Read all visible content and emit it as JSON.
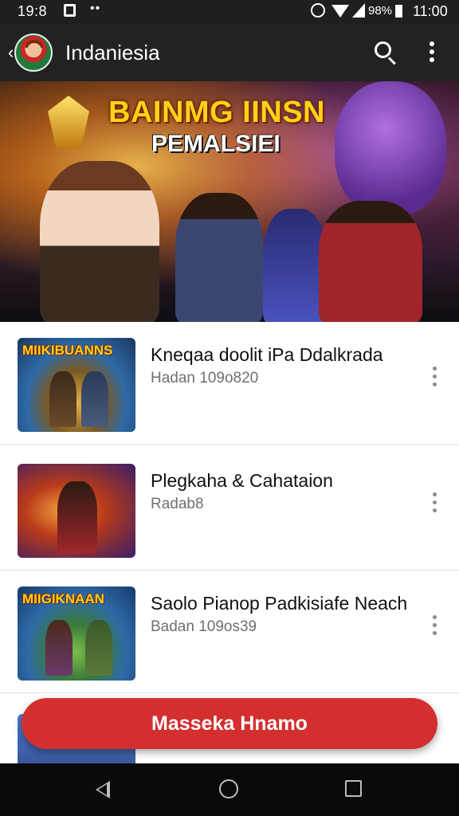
{
  "status_bar": {
    "time_left": "19:8",
    "battery": "98%",
    "time_right": "11:00",
    "icons": [
      "notification-icon",
      "more-dots-icon",
      "alarm-icon",
      "wifi-icon",
      "signal-icon",
      "battery-icon"
    ]
  },
  "app_bar": {
    "title": "Indaniesia",
    "icons": [
      "back-arrow-icon",
      "app-logo",
      "search-icon",
      "more-vert-icon"
    ]
  },
  "hero": {
    "title": "BAINMG IINSN",
    "subtitle": "PEMALSIEI",
    "carousel": {
      "count": 4,
      "active_index": 0,
      "active_color": "#ffffff",
      "inactive_color": "#c8c8c8"
    }
  },
  "games": [
    {
      "title": "Kneqaa doolit iPa Ddalkrada",
      "subtitle": "Hadan 109o820",
      "thumb_label": "MIIKIBUANNS"
    },
    {
      "title": "Plegkaha & Cahataion",
      "subtitle": "Radab8",
      "thumb_label": ""
    },
    {
      "title": "Saolo Pianop Padkisiafe Neach",
      "subtitle": "Badan 109os39",
      "thumb_label": "MIIGIKNAAN"
    },
    {
      "title": "",
      "subtitle": "",
      "thumb_label": ""
    }
  ],
  "fab": {
    "label": "Masseka Hnamo"
  },
  "nav_bar": {
    "icons": [
      "nav-back-icon",
      "nav-home-icon",
      "nav-recents-icon"
    ]
  },
  "colors": {
    "app_bar": "#222222",
    "status_bar": "#1f1f1f",
    "accent_red": "#d32f2f",
    "subtitle_gray": "#6f6f6f",
    "divider": "#e2e2e2"
  }
}
